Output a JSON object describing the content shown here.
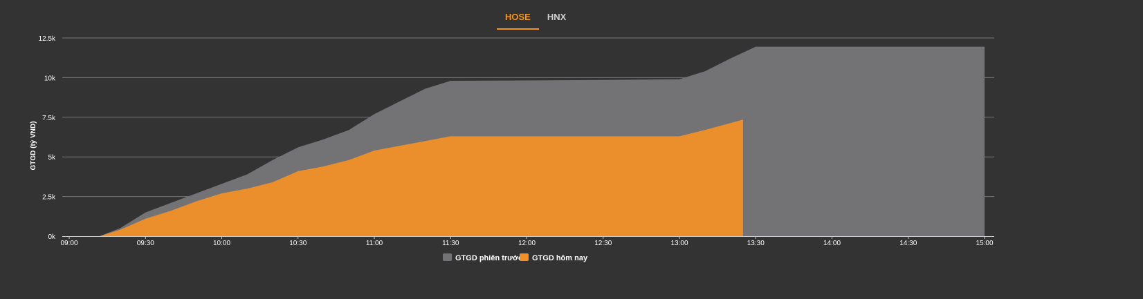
{
  "tabs": [
    {
      "label": "HOSE",
      "active": true
    },
    {
      "label": "HNX",
      "active": false
    }
  ],
  "colors": {
    "background": "#333333",
    "previous_session": "#737375",
    "today": "#f18f28",
    "grid": "#777777",
    "tab_active": "#f7941d"
  },
  "chart_data": {
    "type": "area",
    "ylabel": "GTGD (tỷ VND)",
    "xlabel": "",
    "ylim": [
      0,
      12500
    ],
    "yticks": [
      0,
      2500,
      5000,
      7500,
      10000,
      12500
    ],
    "ytick_labels": [
      "0k",
      "2.5k",
      "5k",
      "7.5k",
      "10k",
      "12.5k"
    ],
    "xticks": [
      "09:00",
      "09:30",
      "10:00",
      "10:30",
      "11:00",
      "11:30",
      "12:00",
      "12:30",
      "13:00",
      "13:30",
      "14:00",
      "14:30",
      "15:00"
    ],
    "xlim": [
      "09:00",
      "15:00"
    ],
    "legend_position": "bottom-center",
    "grid": true,
    "series": [
      {
        "name": "GTGD phiên trước",
        "color": "#737375",
        "points": [
          [
            "09:00",
            0
          ],
          [
            "09:12",
            0
          ],
          [
            "09:20",
            500
          ],
          [
            "09:30",
            1500
          ],
          [
            "09:40",
            2100
          ],
          [
            "09:50",
            2700
          ],
          [
            "10:00",
            3300
          ],
          [
            "10:10",
            3900
          ],
          [
            "10:20",
            4800
          ],
          [
            "10:30",
            5600
          ],
          [
            "10:40",
            6100
          ],
          [
            "10:50",
            6700
          ],
          [
            "11:00",
            7700
          ],
          [
            "11:10",
            8500
          ],
          [
            "11:20",
            9300
          ],
          [
            "11:30",
            9800
          ],
          [
            "12:00",
            9820
          ],
          [
            "12:30",
            9850
          ],
          [
            "13:00",
            9900
          ],
          [
            "13:10",
            10400
          ],
          [
            "13:20",
            11200
          ],
          [
            "13:30",
            11950
          ],
          [
            "15:00",
            11950
          ]
        ]
      },
      {
        "name": "GTGD hôm nay",
        "color": "#f18f28",
        "points": [
          [
            "09:00",
            0
          ],
          [
            "09:12",
            0
          ],
          [
            "09:20",
            400
          ],
          [
            "09:30",
            1100
          ],
          [
            "09:40",
            1600
          ],
          [
            "09:50",
            2200
          ],
          [
            "10:00",
            2700
          ],
          [
            "10:10",
            3000
          ],
          [
            "10:20",
            3400
          ],
          [
            "10:30",
            4100
          ],
          [
            "10:40",
            4400
          ],
          [
            "10:50",
            4800
          ],
          [
            "11:00",
            5400
          ],
          [
            "11:10",
            5700
          ],
          [
            "11:20",
            6000
          ],
          [
            "11:30",
            6300
          ],
          [
            "12:00",
            6300
          ],
          [
            "12:30",
            6300
          ],
          [
            "13:00",
            6300
          ],
          [
            "13:10",
            6700
          ],
          [
            "13:25",
            7350
          ]
        ]
      }
    ]
  }
}
